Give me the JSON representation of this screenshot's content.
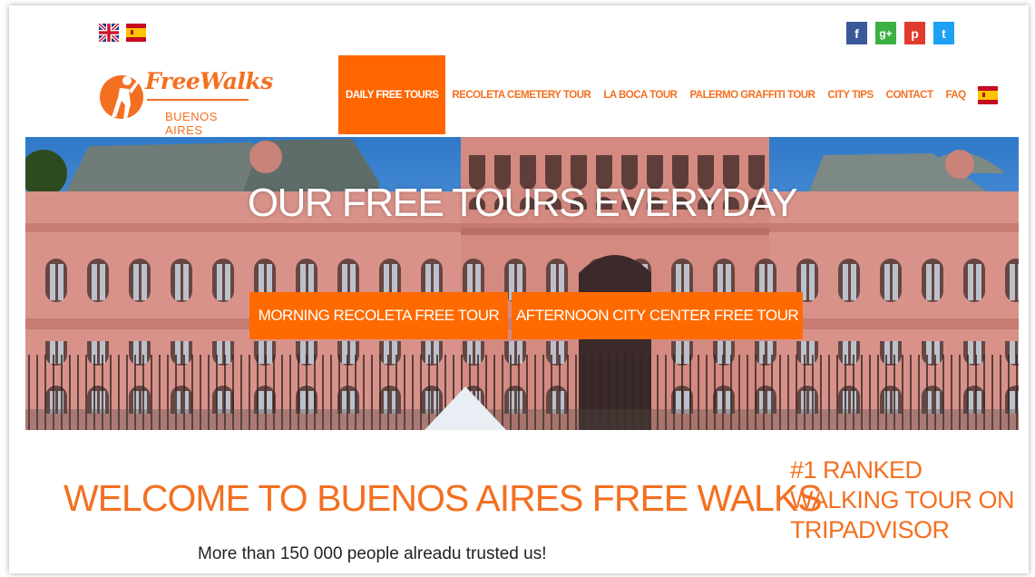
{
  "header": {
    "languages": [
      {
        "name": "English",
        "icon": "uk-flag-icon"
      },
      {
        "name": "Español",
        "icon": "spain-flag-icon"
      }
    ],
    "social": [
      {
        "label": "f",
        "icon": "facebook-icon",
        "color": "#3b5998"
      },
      {
        "label": "g+",
        "icon": "google-plus-icon",
        "color": "#3cb043"
      },
      {
        "label": "p",
        "icon": "pinterest-icon",
        "color": "#e03c2d"
      },
      {
        "label": "t",
        "icon": "twitter-icon",
        "color": "#1da1f2"
      }
    ]
  },
  "logo": {
    "title": "FreeWalks",
    "subtitle": "BUENOS AIRES"
  },
  "nav": {
    "items": [
      {
        "label": "DAILY FREE TOURS",
        "active": true
      },
      {
        "label": "RECOLETA CEMETERY TOUR"
      },
      {
        "label": "LA BOCA TOUR"
      },
      {
        "label": "PALERMO GRAFFITI TOUR"
      },
      {
        "label": "CITY TIPS"
      },
      {
        "label": "CONTACT"
      },
      {
        "label": "FAQ"
      }
    ]
  },
  "hero": {
    "title": "OUR FREE TOURS EVERYDAY",
    "buttons": [
      {
        "label": "MORNING RECOLETA FREE TOUR"
      },
      {
        "label": "AFTERNOON CITY CENTER FREE TOUR"
      }
    ]
  },
  "main": {
    "welcome": "WELCOME TO BUENOS AIRES FREE WALKS",
    "trusted": "More than 150 000 people alreadu trusted us!",
    "ranked": "#1 RANKED WALKING TOUR ON TRIPADVISOR"
  },
  "colors": {
    "accent": "#f37021",
    "nav_active": "#ff6600",
    "building": "#d9928a"
  }
}
